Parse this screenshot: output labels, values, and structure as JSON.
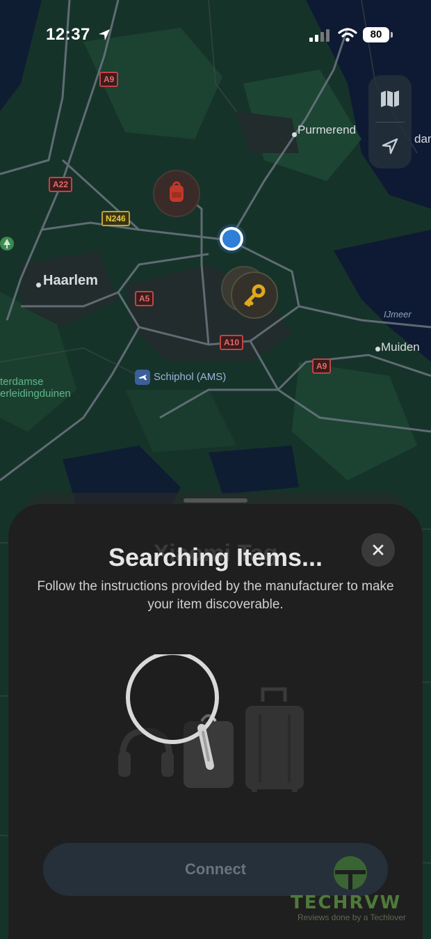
{
  "status_bar": {
    "time": "12:37",
    "battery": "80"
  },
  "map": {
    "places": {
      "purmerend": "Purmerend",
      "haarlem": "Haarlem",
      "muiden": "Muiden",
      "ijmeer": "IJmeer",
      "schiphol": "Schiphol (AMS)",
      "duinen_1": "terdamse",
      "duinen_2": "erleidingduinen",
      "edge_dam": "dam"
    },
    "roads": {
      "a9_top": "A9",
      "a22": "A22",
      "n246": "N246",
      "a5": "A5",
      "a10": "A10",
      "a9_right": "A9"
    }
  },
  "sheet": {
    "title": "Searching Items...",
    "title_ghost": "Xiaomi Tag",
    "subtitle": "Follow the instructions provided by the manufacturer to make your item discoverable.",
    "connect_label": "Connect"
  },
  "watermark": {
    "brand": "TECHRVW",
    "tagline": "Reviews done by a Techlover"
  },
  "colors": {
    "accent_blue": "#2f7fd6",
    "sheet_bg": "#1f1f1f",
    "key_yellow": "#e0a81c",
    "backpack_red": "#c0392b"
  }
}
